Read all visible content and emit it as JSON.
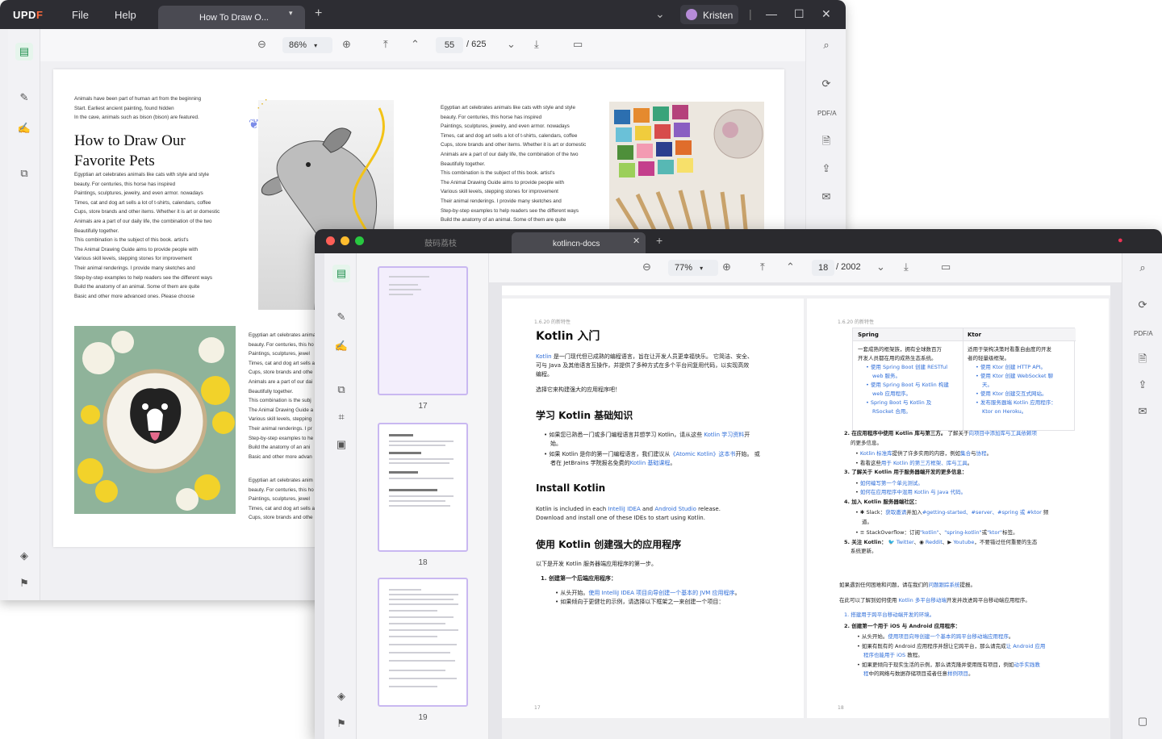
{
  "win1": {
    "logo": "UPDF",
    "menu": [
      "File",
      "Help"
    ],
    "tab_title": "How To Draw O...",
    "user_name": "Kristen",
    "zoom": "86%",
    "page_current": "55",
    "page_total": "/ 625",
    "page": {
      "intro": [
        "Animals have been part of human art from the beginning",
        "Start. Earliest ancient painting, found hidden",
        "In the cave, animals such as bison (bison) are featured."
      ],
      "heading": [
        "How to Draw Our",
        "Favorite Pets"
      ],
      "body_left": [
        "Egyptian art celebrates animals like cats with style and style",
        "beauty. For centuries, this horse has inspired",
        "Paintings, sculptures, jewelry, and even armor. nowadays",
        "Times, cat and dog art sells a lot of t-shirts, calendars, coffee",
        "Cups, store brands and other items. Whether it is art or domestic",
        "Animals are a part of our daily life, the combination of the two",
        "Beautifully together.",
        "This combination is the subject of this book. artist's",
        "The Animal Drawing Guide aims to provide people with",
        "Various skill levels, stepping stones for improvement",
        "Their animal renderings. I provide many sketches and",
        "Step-by-step examples to help readers see the different ways",
        "Build the anatomy of an animal. Some of them are quite",
        "Basic and other more advanced ones. Please choose"
      ],
      "body_right": [
        "Egyptian art celebrates animals like cats with style and style",
        "beauty. For centuries, this horse has inspired",
        "Paintings, sculptures, jewelry, and even armor. nowadays",
        "Times, cat and dog art sells a lot of t-shirts, calendars, coffee",
        "Cups, store brands and other items. Whether it is art or domestic",
        "Animals are a part of our daily life, the combination of the two",
        "Beautifully together.",
        "This combination is the subject of this book. artist's",
        "The Animal Drawing Guide aims to provide people with",
        "Various skill levels, stepping stones for improvement",
        "Their animal renderings. I provide many sketches and",
        "Step-by-step examples to help readers see the different ways",
        "Build the anatomy of an animal. Some of them are quite"
      ],
      "body_mid": [
        "Egyptian art celebrates anima",
        "beauty. For centuries, this ho",
        "Paintings, sculptures, jewel",
        "Times, cat and dog art sells a",
        "Cups, store brands and othe",
        "Animals are a part of our dai",
        "Beautifully together.",
        "This combination is the subj",
        "The Animal Drawing Guide a",
        "Various skill levels, stepping",
        "Their animal renderings. I pr",
        "Step-by-step examples to he",
        "Build the anatomy of an ani",
        "Basic and other more advan"
      ],
      "body_mid2": [
        "Egyptian art celebrates anim",
        "beauty. For centuries, this ho",
        "Paintings, sculptures, jewel",
        "Times, cat and dog art sells a",
        "Cups, store brands and othe"
      ]
    }
  },
  "win2": {
    "tab_inactive": "鼓码荔枝",
    "tab_active": "kotlincn-docs",
    "zoom": "77%",
    "page_current": "18",
    "page_total": "/ 2002",
    "thumb_numbers": [
      "17",
      "18",
      "19"
    ],
    "left_page": {
      "header": "1.6.20 的新特性",
      "title": "Kotlin 入门",
      "p1_a": "Kotlin",
      "p1_b": " 是一门现代但已成熟的编程语言，旨在让开发人员更幸福快乐。 它简洁、安全、",
      "p1_c": "可与 Java 及其他语言互操作，并提供了多种方式在多个平台间复用代码，以实现高效",
      "p1_d": "编程。",
      "p2": "选择它来构建强大的应用程序吧！",
      "h2": "学习 Kotlin 基础知识",
      "b1_a": "• 如果您已熟悉一门或多门编程语言并想学习 Kotlin，请从这些 ",
      "b1_link": "Kotlin 学习资料",
      "b1_c": "开",
      "b1_d": "始。",
      "b2_a": "• 如果 Kotlin 是你的第一门编程语言，我们建议从",
      "b2_link": "《Atomic Kotlin》这本书",
      "b2_c": "开始。 或",
      "b2_d": "者在 JetBrains 学院报名免费的",
      "b2_link2": "Kotlin 基础课程",
      "b2_e": "。",
      "h3": "Install Kotlin",
      "p3_a": "Kotlin is included in each ",
      "p3_link1": "IntelliJ IDEA",
      "p3_b": " and ",
      "p3_link2": "Android Studio",
      "p3_c": " release.",
      "p4": "Download and install one of these IDEs to start using Kotlin.",
      "h4": "使用 Kotlin 创建强大的应用程序",
      "p5": "以下是开发 Kotlin 服务器端应用程序的第一步。",
      "ol1": "1. 创建第一个后端应用程序：",
      "ol1a_a": "• 从头开始。",
      "ol1a_link": "使用 IntelliJ IDEA 项目向导创建一个基本的 JVM 应用程序",
      "ol1a_b": "。",
      "ol1b": "• 如果倾向于更健壮的示例，请选择以下框架之一来创建一个项目：",
      "footer": "17"
    },
    "right_page": {
      "header": "1.6.20 的新特性",
      "col_spring": "Spring",
      "col_ktor": "Ktor",
      "spring_desc": [
        "一套成熟的框架族，拥有全球数百万",
        "开发人员都在用的成熟生态系统。"
      ],
      "spring_links": [
        "使用 Spring Boot 创建 RESTful",
        "web 服务。",
        "使用 Spring Boot 与 Kotlin 构建",
        "web 应用程序。",
        "Spring Boot 与 Kotlin 及",
        "RSocket 合用。"
      ],
      "ktor_desc": [
        "适用于架构决策时看重自由度的开发",
        "者的轻量级框架。"
      ],
      "ktor_links": [
        "使用 Ktor 创建 HTTP API。",
        "使用 Ktor 创建 WebSocket 聊",
        "天。",
        "使用 Ktor 创建交互式网站。",
        "发布服务器端 Kotlin 应用程序：",
        "Ktor on Heroku。"
      ],
      "l2_a": "2. 在应用程序中使用 Kotlin 库与第三方。",
      "l2_b": " 了解关于",
      "l2_link": "向项目中添加库与工具依赖项",
      "l2_c": "的更多信息。",
      "l2_i1": "Kotlin 标准库",
      "l2_i1b": "提供了许多实用的内容，例如",
      "l2_i1c": "集合",
      "l2_i1d": "与",
      "l2_i1e": "协程",
      "l2_i1f": "。",
      "l2_i2": "看看这些",
      "l2_i2l": "用于 Kotlin 的第三方框架、库与工具",
      "l2_i2b": "。",
      "l3": "3. 了解关于 Kotlin 用于服务器端开发的更多信息：",
      "l3_i1": "如何编写第一个单元测试。",
      "l3_i2": "如何在应用程序中混用 Kotlin 与 Java 代码。",
      "l4": "4. 加入 Kotlin 服务器端社区：",
      "l4_i1_a": "Slack：",
      "l4_i1_l": "获取邀请",
      "l4_i1_b": "并加入",
      "l4_i1_tags": "#getting-started、#server、#spring 或 #ktor",
      "l4_i1_c": " 频",
      "l4_i1_d": "道。",
      "l4_i2_a": "StackOverflow：订阅",
      "l4_i2_t1": "\"kotlin\"",
      "l4_i2_b": "、",
      "l4_i2_t2": "\"spring-kotlin\"",
      "l4_i2_c": "或",
      "l4_i2_t3": "\"ktor\"",
      "l4_i2_d": "标签。",
      "l5_a": "5. 关注 Kotlin：",
      "l5_tw": "Twitter",
      "l5_rd": "Reddit",
      "l5_yt": "Youtube",
      "l5_b": "，不要错过任何重要的生态",
      "l5_c": "系统更新。",
      "p_a": "如果遇到任何困难和问题，请在我们的",
      "p_link": "问题跟踪系统",
      "p_b": "提报。",
      "p2_a": "在此可以了解到如何使用 ",
      "p2_link": "Kotlin 多平台移动端",
      "p2_b": "开发并改进跨平台移动端应用程序。",
      "m1": "1. 搭建用于跨平台移动端开发的环境。",
      "m2": "2. 创建第一个用于 iOS 与 Android 应用程序：",
      "m2_i1_a": "从头开始。",
      "m2_i1_l": "使用项目向导创建一个基本的跨平台移动端应用程序",
      "m2_i1_b": "。",
      "m2_i2_a": "如果有既有的 Android 应用程序并想让它跨平台，那么请完成",
      "m2_i2_l": "让 Android 应用",
      "m2_i2_l2": "程序也能用于 iOS",
      "m2_i2_b": " 教程。",
      "m2_i3_a": "如果更倾向于现实生活的示例，那么请克隆并使用既有项目，例如",
      "m2_i3_l": "动手实践教",
      "m2_i3_l2": "程",
      "m2_i3_b": "中的网络与数据存储项目或者任意",
      "m2_i3_l3": "样例项目",
      "m2_i3_c": "。",
      "footer": "18"
    }
  },
  "colors": {
    "accent": "#2e6dd8",
    "brand_green": "#1f8f4d",
    "selection": "#c9b8f1"
  }
}
